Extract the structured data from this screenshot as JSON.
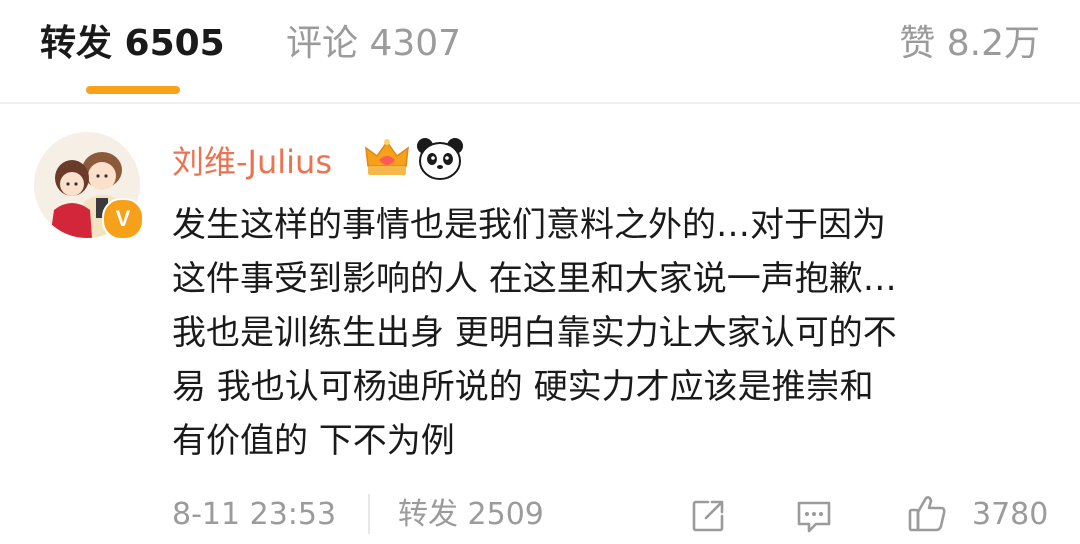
{
  "tabs": {
    "repost": "转发 6505",
    "comment": "评论 4307",
    "like": "赞 8.2万"
  },
  "comment": {
    "username": "刘维-Julius",
    "badges": [
      "crown-icon",
      "panda-icon"
    ],
    "verified_mark": "V",
    "lines": [
      "发生这样的事情也是我们意料之外的…对于因为",
      "这件事受到影响的人 在这里和大家说一声抱歉…",
      "我也是训练生出身 更明白靠实力让大家认可的不",
      "易 我也认可杨迪所说的 硬实力才应该是推崇和",
      "有价值的 下不为例"
    ],
    "time": "8-11 23:53",
    "repost": "转发 2509",
    "likes": "3780"
  },
  "colors": {
    "accent": "#f8a21b",
    "username": "#eb7350",
    "muted": "#9b9b9b",
    "text": "#1a1a1a"
  }
}
